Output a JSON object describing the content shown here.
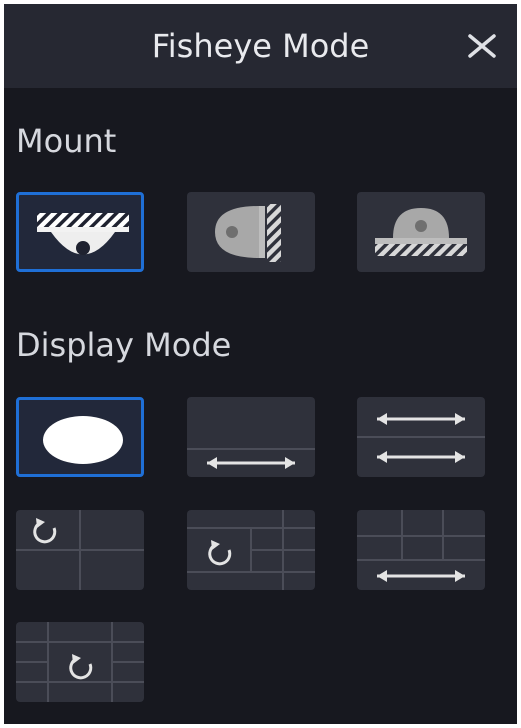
{
  "dialog": {
    "title": "Fisheye Mode",
    "close_icon": "close-icon"
  },
  "mount": {
    "label": "Mount",
    "options": [
      {
        "name": "ceiling-mount",
        "icon": "ceiling-mount-icon",
        "selected": true
      },
      {
        "name": "wall-mount",
        "icon": "wall-mount-icon",
        "selected": false
      },
      {
        "name": "desktop-mount",
        "icon": "desktop-mount-icon",
        "selected": false
      }
    ]
  },
  "display_mode": {
    "label": "Display Mode",
    "options": [
      {
        "name": "fisheye-original",
        "icon": "circle-view-icon",
        "selected": true
      },
      {
        "name": "panorama-360",
        "icon": "panorama-arrow-icon",
        "selected": false
      },
      {
        "name": "panorama-180",
        "icon": "double-panorama-icon",
        "selected": false
      },
      {
        "name": "fisheye-plus-3ptz",
        "icon": "rotate-quad-icon",
        "selected": false
      },
      {
        "name": "fisheye-plus-8ptz",
        "icon": "rotate-grid-icon",
        "selected": false
      },
      {
        "name": "panorama-plus-ptz",
        "icon": "panorama-grid-icon",
        "selected": false
      },
      {
        "name": "fisheye-plus-ptz-grid",
        "icon": "rotate-center-grid-icon",
        "selected": false
      }
    ]
  },
  "colors": {
    "panel": "#17181f",
    "header": "#262832",
    "button": "#2f313b",
    "selected_border": "#1f6fd6"
  }
}
